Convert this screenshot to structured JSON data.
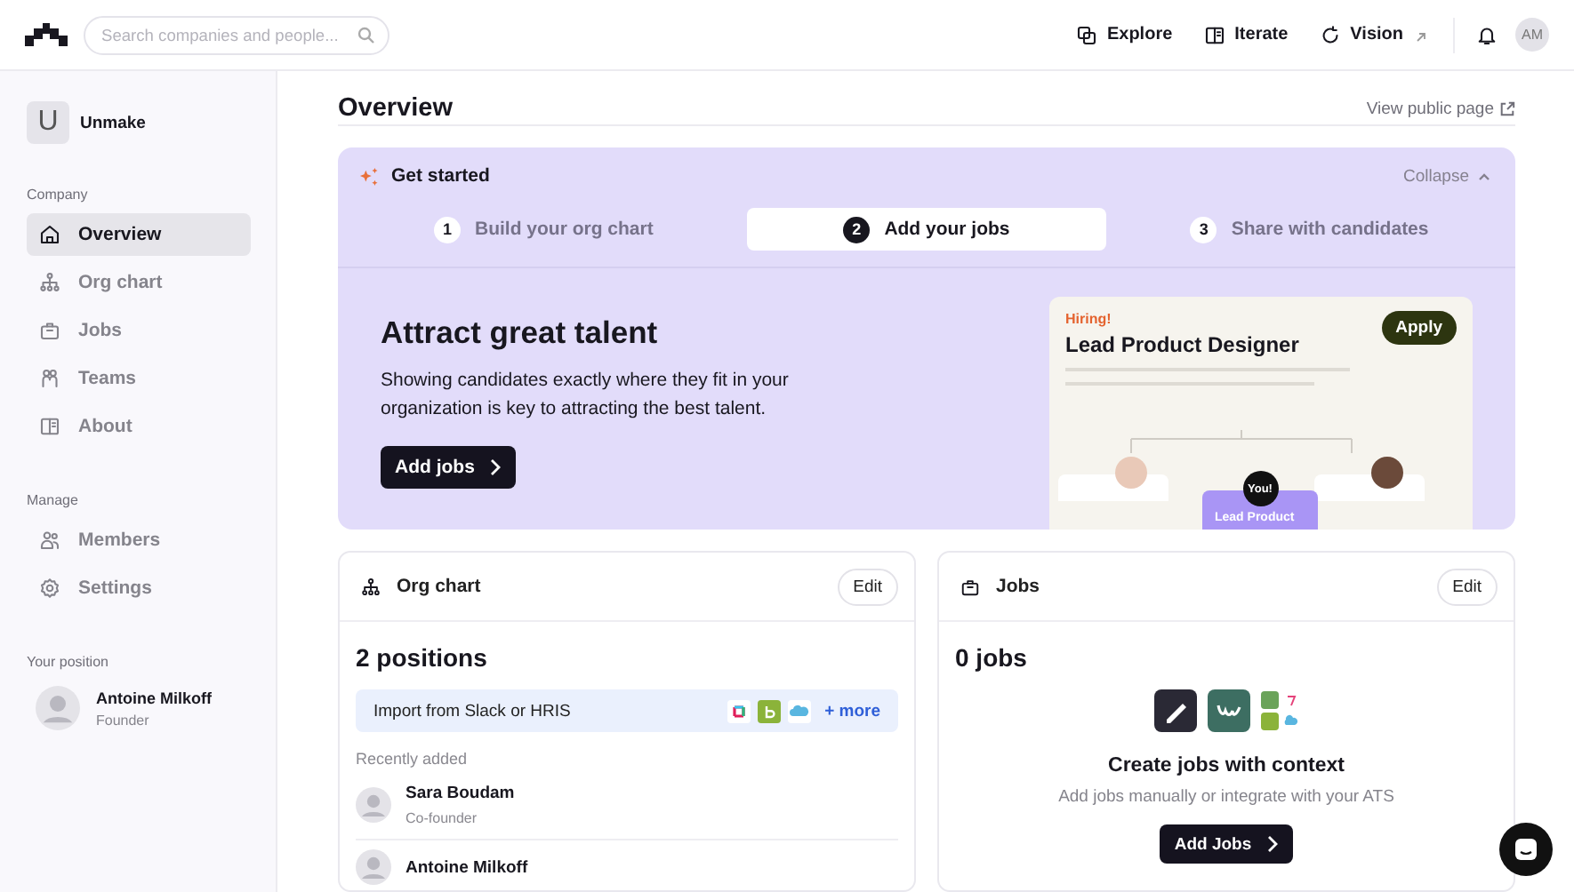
{
  "topbar": {
    "search_placeholder": "Search companies and people...",
    "nav": [
      {
        "label": "Explore",
        "external": false
      },
      {
        "label": "Iterate",
        "external": false
      },
      {
        "label": "Vision",
        "external": true
      }
    ],
    "avatar": "AM"
  },
  "sidebar": {
    "company": {
      "initial": "U",
      "name": "Unmake"
    },
    "sections": [
      {
        "title": "Company",
        "items": [
          {
            "label": "Overview",
            "selected": true
          },
          {
            "label": "Org chart",
            "selected": false
          },
          {
            "label": "Jobs",
            "selected": false
          },
          {
            "label": "Teams",
            "selected": false
          },
          {
            "label": "About",
            "selected": false
          }
        ]
      },
      {
        "title": "Manage",
        "items": [
          {
            "label": "Members",
            "selected": false
          },
          {
            "label": "Settings",
            "selected": false
          }
        ]
      }
    ],
    "position": {
      "title": "Your position",
      "name": "Antoine Milkoff",
      "role": "Founder"
    }
  },
  "page": {
    "title": "Overview",
    "link": "View public page"
  },
  "get_started": {
    "title": "Get started",
    "collapse": "Collapse",
    "steps": [
      {
        "number": "1",
        "label": "Build your org chart",
        "selected": false
      },
      {
        "number": "2",
        "label": "Add your jobs",
        "selected": true
      },
      {
        "number": "3",
        "label": "Share with candidates",
        "selected": false
      }
    ],
    "heading": "Attract great talent",
    "text": "Showing candidates exactly where they fit in your organization is key to attracting the best talent.",
    "button": "Add jobs",
    "preview": {
      "tag": "Hiring!",
      "title": "Lead Product Designer",
      "button": "Apply",
      "badge": "You!",
      "node_label": "Lead Product"
    }
  },
  "org_chart": {
    "title": "Org chart",
    "edit": "Edit",
    "count": "2 positions",
    "import": {
      "label": "Import from Slack or HRIS",
      "more": "+ more"
    },
    "recent_title": "Recently added",
    "people": [
      {
        "name": "Sara Boudam",
        "role": "Co-founder"
      },
      {
        "name": "Antoine Milkoff"
      }
    ]
  },
  "jobs": {
    "title": "Jobs",
    "edit": "Edit",
    "count": "0 jobs",
    "heading": "Create jobs with context",
    "text": "Add jobs manually or integrate with your ATS",
    "button": "Add Jobs"
  }
}
